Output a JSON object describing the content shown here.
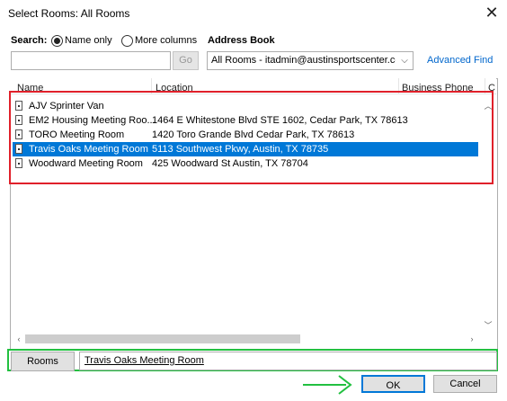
{
  "window": {
    "title": "Select Rooms: All Rooms",
    "close_icon": "close-icon"
  },
  "search": {
    "label": "Search:",
    "options": [
      "Name only",
      "More columns"
    ],
    "selected": "Name only",
    "input_value": "",
    "go_label": "Go"
  },
  "address_book": {
    "label": "Address Book",
    "selected": "All Rooms - itadmin@austinsportscenter.cor",
    "advanced_find": "Advanced Find"
  },
  "table": {
    "columns": [
      "Name",
      "Location",
      "Business Phone",
      "C"
    ],
    "rows": [
      {
        "name": "AJV Sprinter Van",
        "location": "",
        "selected": false
      },
      {
        "name": "EM2 Housing Meeting Roo...",
        "location": "1464 E Whitestone Blvd STE 1602, Cedar Park, TX 78613",
        "selected": false
      },
      {
        "name": "TORO Meeting Room",
        "location": "1420 Toro Grande Blvd Cedar Park, TX 78613",
        "selected": false
      },
      {
        "name": "Travis Oaks Meeting Room",
        "location": "5113 Southwest Pkwy, Austin, TX 78735",
        "selected": true
      },
      {
        "name": "Woodward Meeting Room",
        "location": "425 Woodward St Austin, TX 78704",
        "selected": false
      }
    ]
  },
  "rooms": {
    "button_label": "Rooms",
    "value": "Travis Oaks Meeting Room"
  },
  "footer": {
    "ok_label": "OK",
    "cancel_label": "Cancel"
  },
  "colors": {
    "selection": "#0078d7",
    "highlight_red": "#e0202a",
    "highlight_green": "#22c040"
  }
}
